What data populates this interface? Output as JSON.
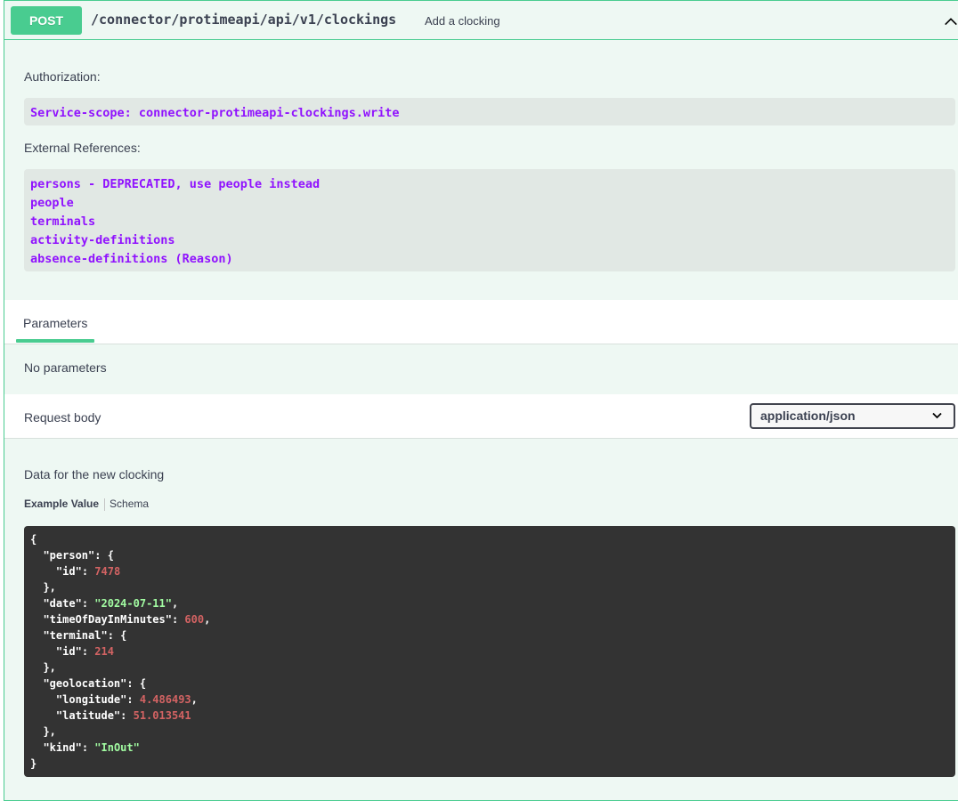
{
  "operation": {
    "method": "POST",
    "path": "/connector/protimeapi/api/v1/clockings",
    "summary": "Add a clocking"
  },
  "authorization": {
    "label": "Authorization:",
    "scope": "Service-scope: connector-protimeapi-clockings.write"
  },
  "external_references": {
    "label": "External References:",
    "items": [
      "persons - DEPRECATED, use people instead",
      "people",
      "terminals",
      "activity-definitions",
      "absence-definitions (Reason)"
    ]
  },
  "parameters": {
    "tab_label": "Parameters",
    "empty_text": "No parameters"
  },
  "request_body": {
    "label": "Request body",
    "content_type": "application/json",
    "description": "Data for the new clocking",
    "example_tab": "Example Value",
    "schema_tab": "Schema"
  },
  "example": {
    "person_key": "\"person\"",
    "id_key": "\"id\"",
    "person_id": "7478",
    "date_key": "\"date\"",
    "date_value": "\"2024-07-11\"",
    "time_key": "\"timeOfDayInMinutes\"",
    "time_value": "600",
    "terminal_key": "\"terminal\"",
    "terminal_id": "214",
    "geo_key": "\"geolocation\"",
    "lon_key": "\"longitude\"",
    "lon_value": "4.486493",
    "lat_key": "\"latitude\"",
    "lat_value": "51.013541",
    "kind_key": "\"kind\"",
    "kind_value": "\"InOut\""
  },
  "icons": {
    "collapse": "chevron-up-icon",
    "dropdown": "chevron-down-icon"
  },
  "colors": {
    "post": "#49cc90",
    "scope_text": "#9012fe",
    "json_string": "#a2fca2",
    "json_number": "#d36363"
  }
}
